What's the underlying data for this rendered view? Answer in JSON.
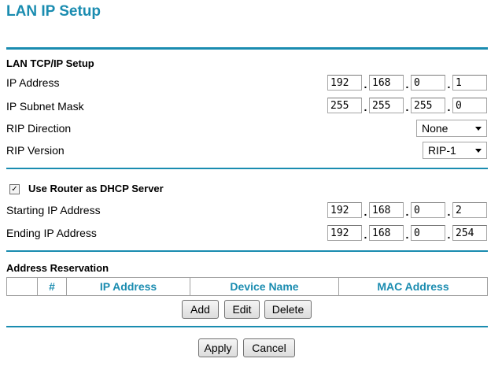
{
  "page": {
    "title": "LAN IP Setup"
  },
  "lan": {
    "heading": "LAN TCP/IP Setup",
    "ip_label": "IP Address",
    "ip": [
      "192",
      "168",
      "0",
      "1"
    ],
    "subnet_label": "IP Subnet Mask",
    "subnet": [
      "255",
      "255",
      "255",
      "0"
    ],
    "rip_direction_label": "RIP Direction",
    "rip_direction_value": "None",
    "rip_version_label": "RIP Version",
    "rip_version_value": "RIP-1"
  },
  "dhcp": {
    "checkbox_checked": true,
    "checkbox_glyph": "✓",
    "checkbox_label": "Use Router as DHCP Server",
    "start_label": "Starting IP Address",
    "start": [
      "192",
      "168",
      "0",
      "2"
    ],
    "end_label": "Ending IP Address",
    "end": [
      "192",
      "168",
      "0",
      "254"
    ]
  },
  "reservation": {
    "heading": "Address Reservation",
    "columns": [
      "",
      "#",
      "IP Address",
      "Device Name",
      "MAC Address"
    ],
    "buttons": {
      "add": "Add",
      "edit": "Edit",
      "delete": "Delete"
    }
  },
  "footer": {
    "apply": "Apply",
    "cancel": "Cancel"
  },
  "colors": {
    "accent": "#1a8cb0"
  }
}
